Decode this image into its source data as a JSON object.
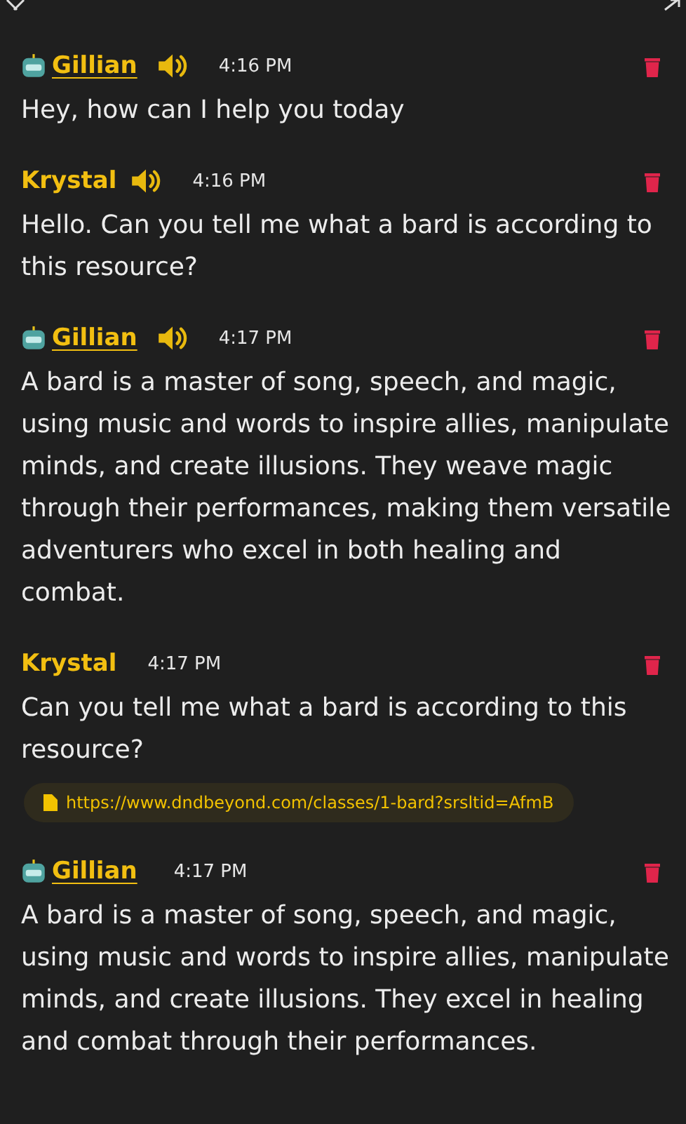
{
  "messages": [
    {
      "kind": "bot",
      "author": "Gillian",
      "speaker": true,
      "time": "4:16 PM",
      "text": "Hey, how can I help you today"
    },
    {
      "kind": "user",
      "author": "Krystal",
      "speaker": true,
      "time": "4:16 PM",
      "text": "Hello. Can you tell me what a bard is according to this resource?"
    },
    {
      "kind": "bot",
      "author": "Gillian",
      "speaker": true,
      "time": "4:17 PM",
      "text": "A bard is a master of song, speech, and magic, using music and words to inspire allies, manipulate minds, and create illusions. They weave magic through their performances, making them versatile adventurers who excel in both healing and combat."
    },
    {
      "kind": "user",
      "author": "Krystal",
      "speaker": false,
      "time": "4:17 PM",
      "text": "Can you tell me what a bard is according to this resource?",
      "attachment": "https://www.dndbeyond.com/classes/1-bard?srsltid=AfmB"
    },
    {
      "kind": "bot",
      "author": "Gillian",
      "speaker": false,
      "time": "4:17 PM",
      "text": "A bard is a master of song, speech, and magic, using music and words to inspire allies, manipulate minds, and create illusions. They excel in healing and combat through their performances."
    }
  ]
}
